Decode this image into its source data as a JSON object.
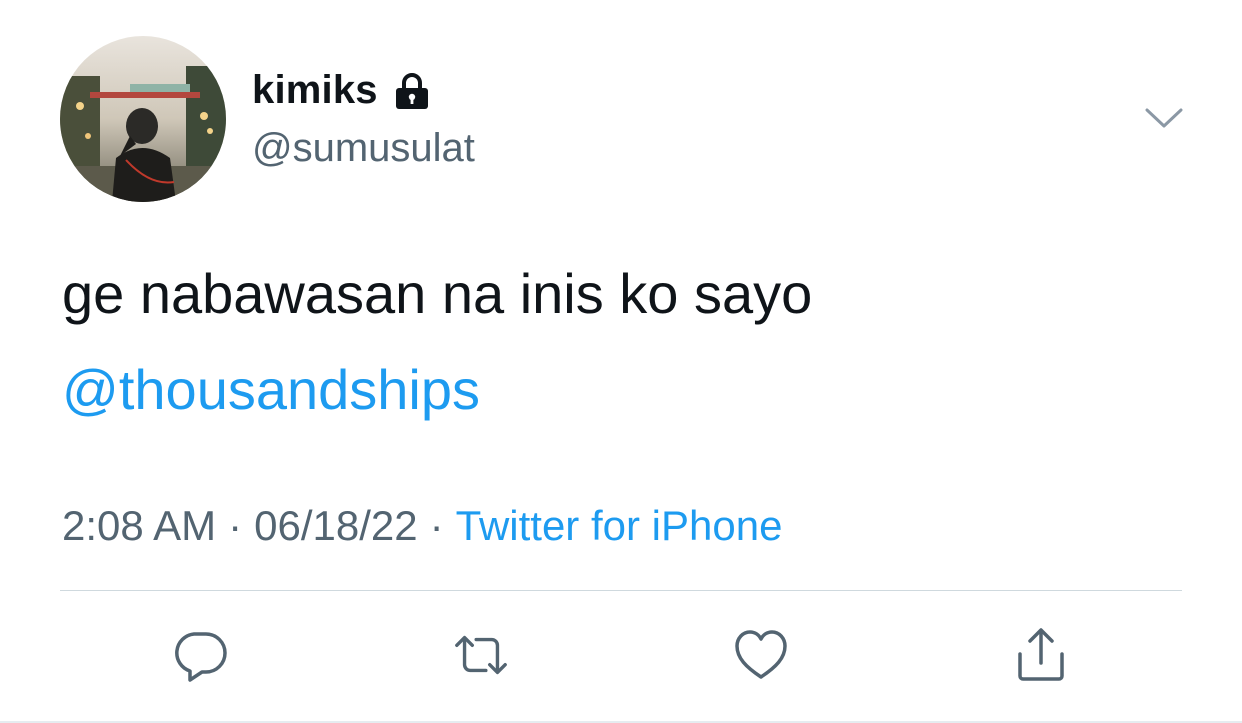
{
  "tweet": {
    "author": {
      "display_name": "kimiks",
      "handle": "@sumusulat",
      "protected_icon": "lock-icon",
      "avatar_icon": "avatar-photo"
    },
    "text": "ge nabawasan na inis ko sayo",
    "mention": "@thousandships",
    "meta": {
      "time": "2:08 AM",
      "separator": "·",
      "date": "06/18/22",
      "source": "Twitter for iPhone"
    },
    "menu_icon": "chevron-down-icon",
    "actions": [
      {
        "icon": "reply-icon"
      },
      {
        "icon": "retweet-icon"
      },
      {
        "icon": "like-icon"
      },
      {
        "icon": "share-icon"
      }
    ]
  },
  "colors": {
    "text": "#0f1419",
    "secondary": "#536471",
    "link": "#1d9bf0",
    "divider": "#cfd9de",
    "icon": "#536471"
  }
}
